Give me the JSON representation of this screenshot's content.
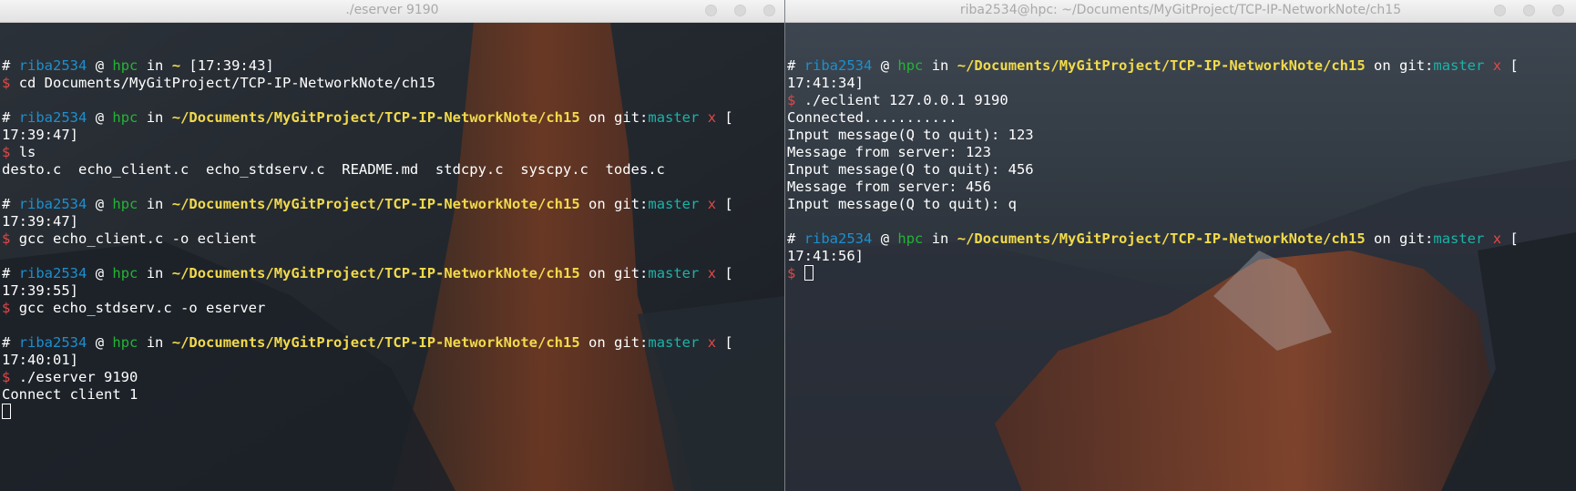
{
  "colors": {
    "hash": "#ffffff",
    "user": "#1d8fcf",
    "host": "#22b534",
    "directory": "#f2da4a",
    "branch": "#1bb3a8",
    "dirty_mark": "#e04848",
    "prompt": "#e04848",
    "text": "#ffffff",
    "titlebar": "#e8e8e8"
  },
  "left": {
    "title": "./eserver 9190",
    "lines": [
      {
        "type": "blank"
      },
      {
        "type": "header",
        "time": "[17:39:43]",
        "dir": "~"
      },
      {
        "type": "cmd",
        "text": "cd Documents/MyGitProject/TCP-IP-NetworkNote/ch15"
      },
      {
        "type": "blank"
      },
      {
        "type": "header",
        "dir": "~/Documents/MyGitProject/TCP-IP-NetworkNote/ch15",
        "git": "master",
        "bracket": "["
      },
      {
        "type": "out",
        "text": "17:39:47]"
      },
      {
        "type": "cmd",
        "text": "ls"
      },
      {
        "type": "out",
        "text": "desto.c  echo_client.c  echo_stdserv.c  README.md  stdcpy.c  syscpy.c  todes.c"
      },
      {
        "type": "blank"
      },
      {
        "type": "header",
        "dir": "~/Documents/MyGitProject/TCP-IP-NetworkNote/ch15",
        "git": "master",
        "bracket": "["
      },
      {
        "type": "out",
        "text": "17:39:47]"
      },
      {
        "type": "cmd",
        "text": "gcc echo_client.c -o eclient"
      },
      {
        "type": "blank"
      },
      {
        "type": "header",
        "dir": "~/Documents/MyGitProject/TCP-IP-NetworkNote/ch15",
        "git": "master",
        "bracket": "["
      },
      {
        "type": "out",
        "text": "17:39:55]"
      },
      {
        "type": "cmd",
        "text": "gcc echo_stdserv.c -o eserver"
      },
      {
        "type": "blank"
      },
      {
        "type": "header",
        "dir": "~/Documents/MyGitProject/TCP-IP-NetworkNote/ch15",
        "git": "master",
        "bracket": "["
      },
      {
        "type": "out",
        "text": "17:40:01]"
      },
      {
        "type": "cmd",
        "text": "./eserver 9190"
      },
      {
        "type": "out",
        "text": "Connect client 1"
      },
      {
        "type": "cursor"
      }
    ]
  },
  "right": {
    "title": "riba2534@hpc: ~/Documents/MyGitProject/TCP-IP-NetworkNote/ch15",
    "lines": [
      {
        "type": "blank"
      },
      {
        "type": "header",
        "dir": "~/Documents/MyGitProject/TCP-IP-NetworkNote/ch15",
        "git": "master",
        "bracket": "["
      },
      {
        "type": "out",
        "text": "17:41:34]"
      },
      {
        "type": "cmd",
        "text": "./eclient 127.0.0.1 9190"
      },
      {
        "type": "out",
        "text": "Connected..........."
      },
      {
        "type": "out",
        "text": "Input message(Q to quit): 123"
      },
      {
        "type": "out",
        "text": "Message from server: 123"
      },
      {
        "type": "out",
        "text": "Input message(Q to quit): 456"
      },
      {
        "type": "out",
        "text": "Message from server: 456"
      },
      {
        "type": "out",
        "text": "Input message(Q to quit): q"
      },
      {
        "type": "blank"
      },
      {
        "type": "header",
        "dir": "~/Documents/MyGitProject/TCP-IP-NetworkNote/ch15",
        "git": "master",
        "bracket": "["
      },
      {
        "type": "out",
        "text": "17:41:56]"
      },
      {
        "type": "cmd",
        "text": "",
        "cursor": true
      }
    ]
  },
  "prompt": {
    "hash": "#",
    "user": "riba2534",
    "at": "@",
    "host": "hpc",
    "in": "in",
    "on": "on",
    "git_prefix": "git:",
    "dirty_mark": "x",
    "symbol": "$"
  }
}
